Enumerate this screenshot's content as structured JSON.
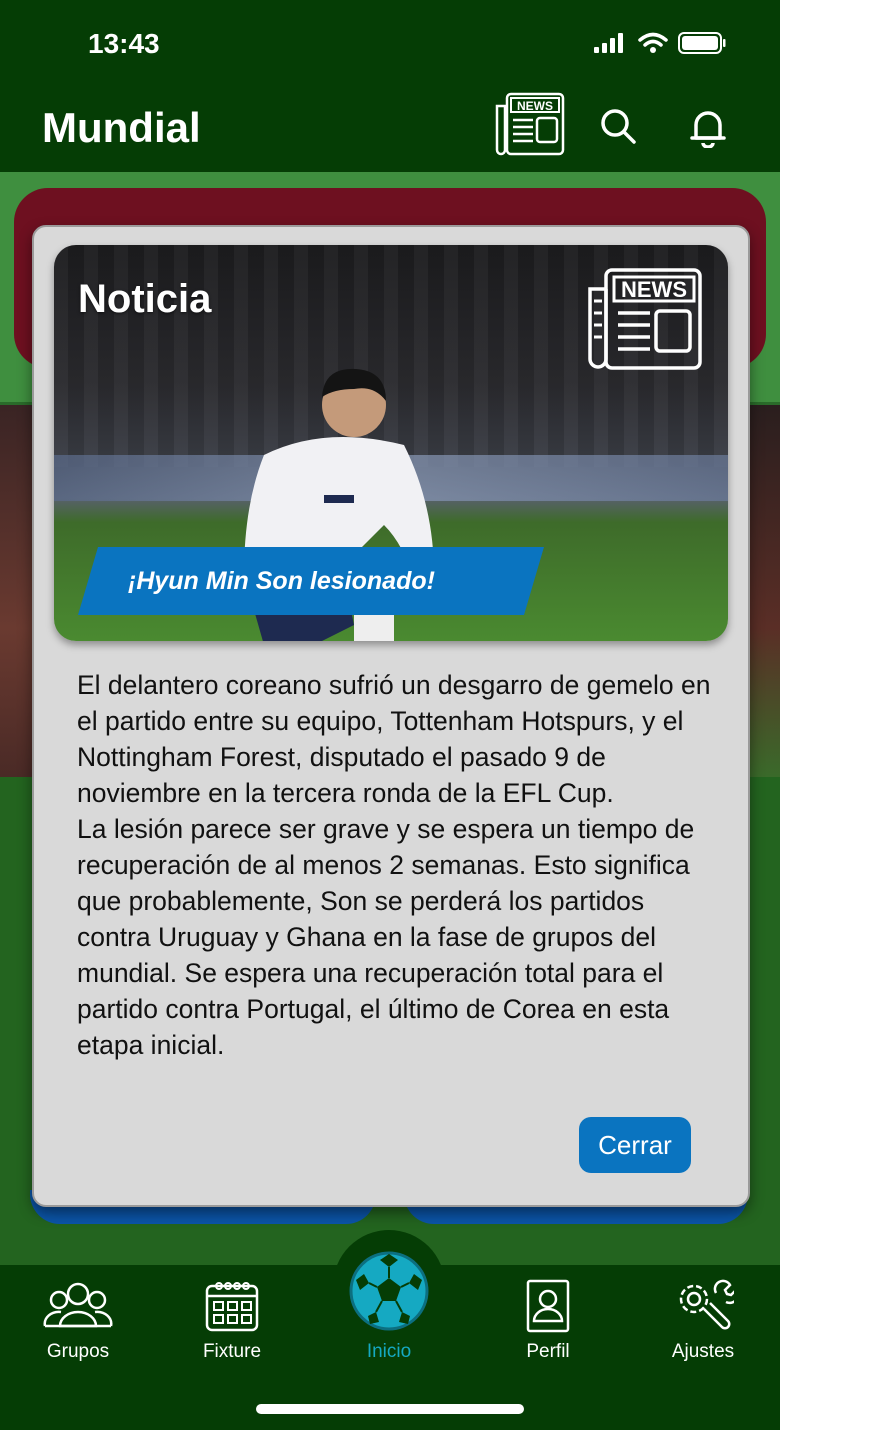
{
  "status_bar": {
    "time": "13:43"
  },
  "header": {
    "title": "Mundial"
  },
  "modal": {
    "title": "Noticia",
    "headline": "¡Hyun Min Son lesionado!",
    "body": [
      "El delantero coreano sufrió un desgarro de gemelo en el partido entre su equipo, Tottenham Hotspurs, y el Nottingham Forest, disputado el pasado 9 de noviembre en la tercera ronda de la EFL Cup.",
      "La lesión parece ser grave y se espera un tiempo de recuperación de al menos 2 semanas. Esto significa que probablemente, Son se perderá los partidos contra Uruguay y Ghana en la fase de grupos del mundial. Se espera una recuperación total para el partido contra Portugal, el último de Corea en esta etapa inicial."
    ],
    "close_label": "Cerrar",
    "news_badge": "NEWS"
  },
  "tabs": [
    {
      "label": "Grupos",
      "icon": "group-icon"
    },
    {
      "label": "Fixture",
      "icon": "calendar-icon"
    },
    {
      "label": "Inicio",
      "icon": "soccer-ball-icon",
      "active": true
    },
    {
      "label": "Perfil",
      "icon": "profile-icon"
    },
    {
      "label": "Ajustes",
      "icon": "settings-icon"
    }
  ],
  "colors": {
    "header_bg": "#053d05",
    "accent_blue": "#0a74c0",
    "active_tab": "#15a9c2",
    "modal_bg": "#d9d9d9"
  }
}
